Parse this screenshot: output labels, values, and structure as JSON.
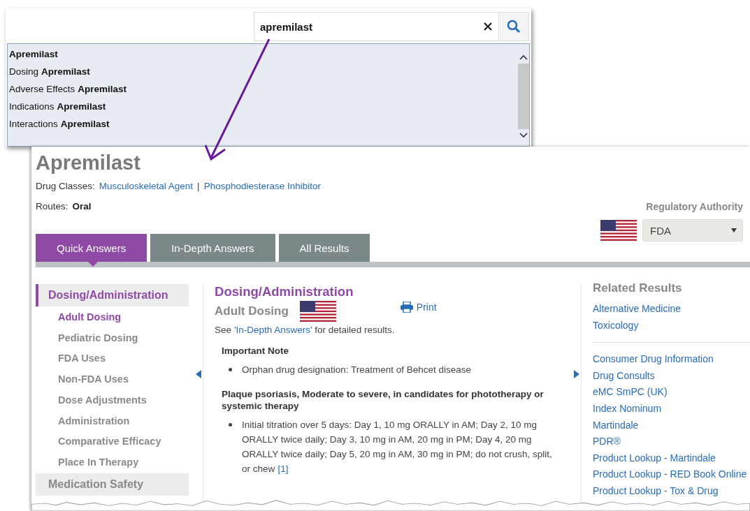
{
  "search": {
    "value": "apremilast"
  },
  "suggestions": [
    {
      "match": "Apremilast"
    },
    {
      "prefix": "Dosing",
      "match": "Apremilast"
    },
    {
      "prefix": "Adverse Effects",
      "match": "Apremilast"
    },
    {
      "prefix": "Indications",
      "match": "Apremilast"
    },
    {
      "prefix": "Interactions",
      "match": "Apremilast"
    }
  ],
  "drug": {
    "title": "Apremilast",
    "classes_label": "Drug Classes:",
    "classes": [
      "Musculoskeletal Agent",
      "Phosphodiesterase Inhibitor"
    ],
    "classes_separator": "|",
    "routes_label": "Routes:",
    "routes_value": "Oral"
  },
  "regulatory": {
    "label": "Regulatory Authority",
    "value": "FDA"
  },
  "tabs": [
    {
      "label": "Quick Answers",
      "selected": true
    },
    {
      "label": "In-Depth Answers",
      "selected": false
    },
    {
      "label": "All Results",
      "selected": false
    }
  ],
  "sidebar": [
    {
      "label": "Dosing/Administration",
      "selected": true,
      "children": [
        {
          "label": "Adult Dosing",
          "selected": true
        },
        {
          "label": "Pediatric Dosing",
          "selected": false
        },
        {
          "label": "FDA Uses",
          "selected": false
        },
        {
          "label": "Non-FDA Uses",
          "selected": false
        },
        {
          "label": "Dose Adjustments",
          "selected": false
        },
        {
          "label": "Administration",
          "selected": false
        },
        {
          "label": "Comparative Efficacy",
          "selected": false
        },
        {
          "label": "Place In Therapy",
          "selected": false
        }
      ]
    },
    {
      "label": "Medication Safety",
      "selected": false
    }
  ],
  "main": {
    "heading": "Dosing/Administration",
    "subheading": "Adult Dosing",
    "print": "Print",
    "note_before": "See ",
    "note_link": "'In-Depth Answers'",
    "note_after": " for detailed results.",
    "blocks": [
      {
        "heading": "Important Note",
        "bullets": [
          {
            "text": "Orphan drug designation: Treatment of Behcet disease"
          }
        ]
      },
      {
        "heading": "Plaque psoriasis, Moderate to severe, in candidates for phototherapy or systemic therapy",
        "bullets": [
          {
            "text": "Initial titration over 5 days: Day 1, 10 mg ORALLY in AM; Day 2, 10 mg ORALLY twice daily; Day 3, 10 mg in AM, 20 mg in PM; Day 4, 20 mg ORALLY twice daily; Day 5, 20 mg in AM, 30 mg in PM; do not crush, split, or chew",
            "ref": "[1]"
          }
        ]
      }
    ]
  },
  "related": {
    "title": "Related Results",
    "groups": [
      [
        "Alternative Medicine",
        "Toxicology"
      ],
      [
        "Consumer Drug Information",
        "Drug Consults",
        "eMC SmPC (UK)",
        "Index Nominum",
        "Martindale",
        "PDR®",
        "Product Lookup - Martindale",
        "Product Lookup - RED Book Online",
        "Product Lookup - Tox & Drug"
      ]
    ]
  }
}
